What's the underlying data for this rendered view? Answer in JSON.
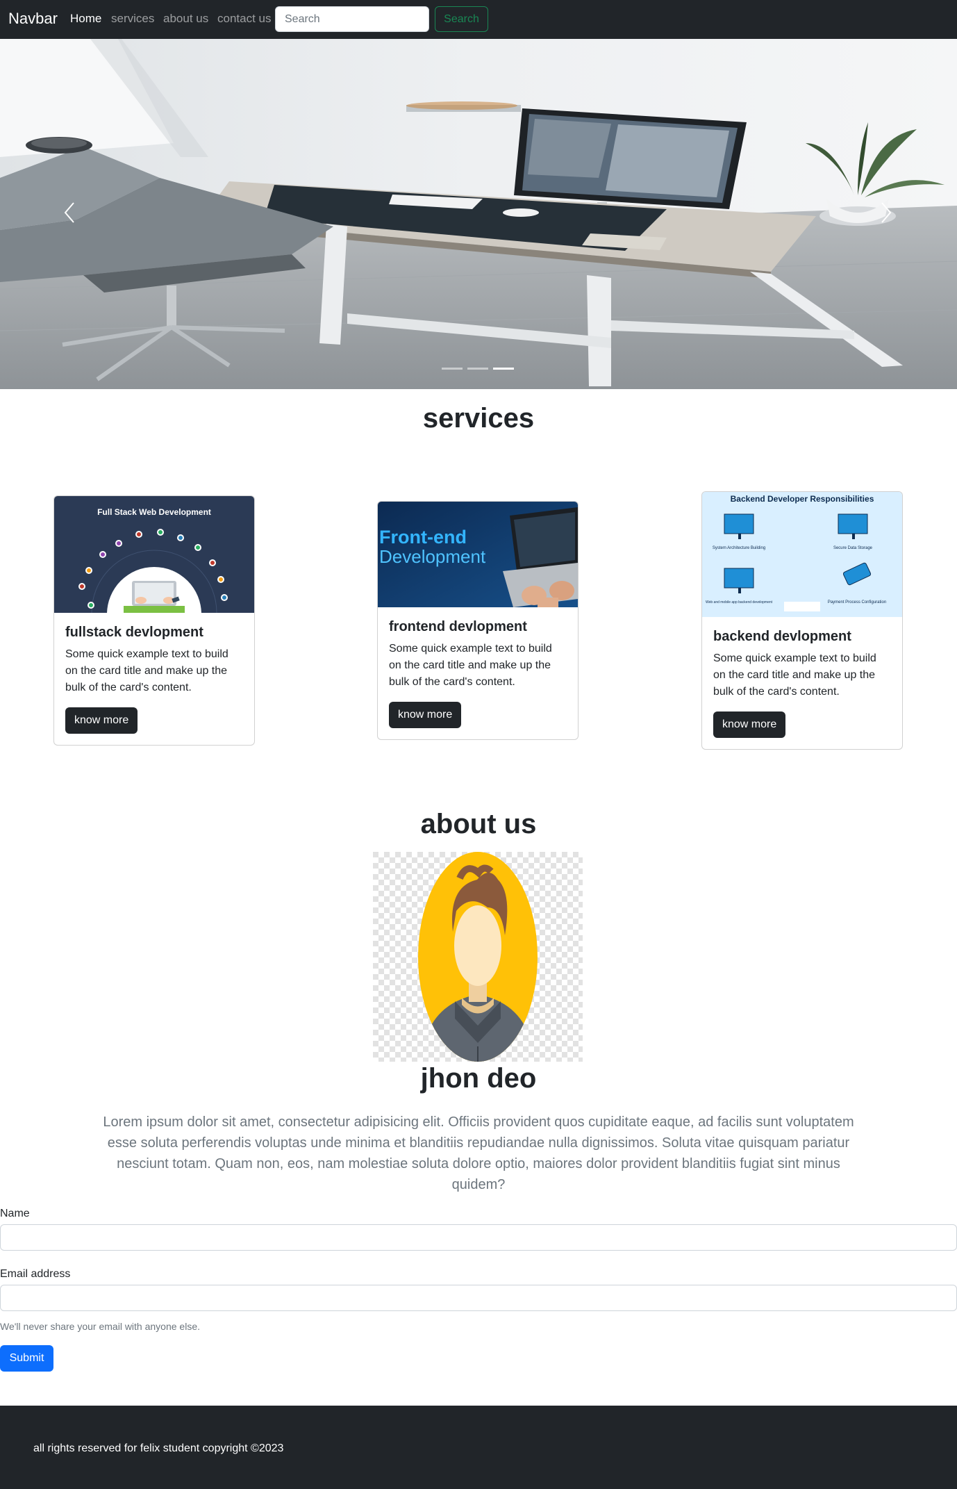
{
  "navbar": {
    "brand": "Navbar",
    "links": [
      "Home",
      "services",
      "about us",
      "contact us"
    ],
    "search_placeholder": "Search",
    "search_button": "Search"
  },
  "carousel": {
    "slide_count": 3,
    "active_slide": 3
  },
  "services": {
    "title": "services",
    "cards": [
      {
        "image_heading": "Full Stack Web Development",
        "title": "fullstack devlopment",
        "text": "Some quick example text to build on the card title and make up the bulk of the card's content.",
        "button": "know more"
      },
      {
        "image_heading_line1": "Front-end",
        "image_heading_line2": "Development",
        "title": "frontend devlopment",
        "text": "Some quick example text to build on the card title and make up the bulk of the card's content.",
        "button": "know more"
      },
      {
        "image_heading": "Backend Developer Responsibilities",
        "image_labels": [
          "System Architecture Building",
          "Secure Data Storage",
          "Web and mobile app backend development",
          "Payment Process Configuration"
        ],
        "title": "backend devlopment",
        "text": "Some quick example text to build on the card title and make up the bulk of the card's content.",
        "button": "know more"
      }
    ]
  },
  "about": {
    "title": "about us",
    "name": "jhon deo",
    "text": "Lorem ipsum dolor sit amet, consectetur adipisicing elit. Officiis provident quos cupiditate eaque, ad facilis sunt voluptatem esse soluta perferendis voluptas unde minima et blanditiis repudiandae nulla dignissimos. Soluta vitae quisquam pariatur nesciunt totam. Quam non, eos, nam molestiae soluta dolore optio, maiores dolor provident blanditiis fugiat sint minus quidem?"
  },
  "form": {
    "name_label": "Name",
    "email_label": "Email address",
    "email_help": "We'll never share your email with anyone else.",
    "submit": "Submit"
  },
  "footer": {
    "text": "all rights reserved for felix student copyright ©2023"
  },
  "colors": {
    "dark": "#212529",
    "primary": "#0d6efd",
    "success": "#198754",
    "muted": "#6c757d"
  }
}
